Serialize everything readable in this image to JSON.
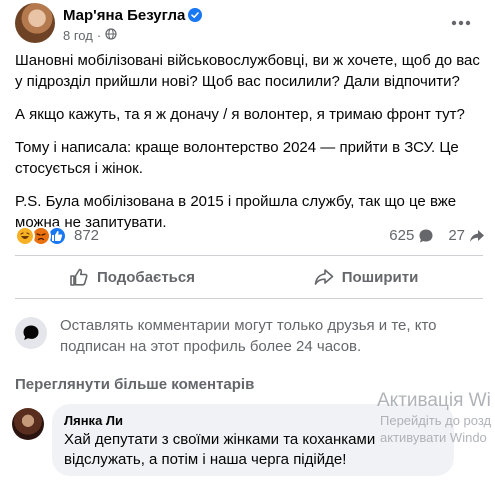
{
  "post": {
    "author": "Мар'яна Безугла",
    "time": "8 год",
    "dot": "·",
    "paragraphs": [
      "Шановні мобілізовані військовослужбовці, ви ж хочете, щоб до вас у підрозділ прийшли нові? Щоб вас посилили? Дали відпочити?",
      "А якщо кажуть, та я ж доначу / я волонтер, я тримаю фронт тут?",
      "Тому і написала: краще волонтерство 2024 — прийти в ЗСУ. Це стосується і жінок.",
      "P.S. Була мобілізована в 2015 і пройшла службу, так що це вже можна не запитувати."
    ]
  },
  "stats": {
    "reactions_count": "872",
    "comments_count": "625",
    "shares_count": "27"
  },
  "actions": {
    "like_label": "Подобається",
    "share_label": "Поширити"
  },
  "notice": {
    "text": "Оставлять комментарии могут только друзья и те, кто подписан на этот профиль более 24 часов."
  },
  "comments": {
    "view_more_label": "Переглянути більше коментарів",
    "items": [
      {
        "author": "Лянка Ли",
        "text": "Хай депутати з своїми жінками та коханками відслужать, а потім і наша черга підійде!"
      }
    ]
  },
  "watermark": {
    "title": "Активація Wi",
    "subtitle_1": "Перейдіть до розд",
    "subtitle_2": "активувати Windo"
  },
  "colors": {
    "accent": "#1877f2",
    "secondary_text": "#65676b",
    "bubble_bg": "#f0f2f5"
  },
  "icons": {
    "verified": "verified-badge-icon",
    "audience": "globe-icon",
    "more": "ellipsis-icon",
    "like": "thumbs-up-icon",
    "share": "share-arrow-icon",
    "comment": "comment-bubble-icon",
    "reaction_haha": "haha-reaction-icon",
    "reaction_angry": "angry-reaction-icon",
    "reaction_like": "like-reaction-icon"
  }
}
